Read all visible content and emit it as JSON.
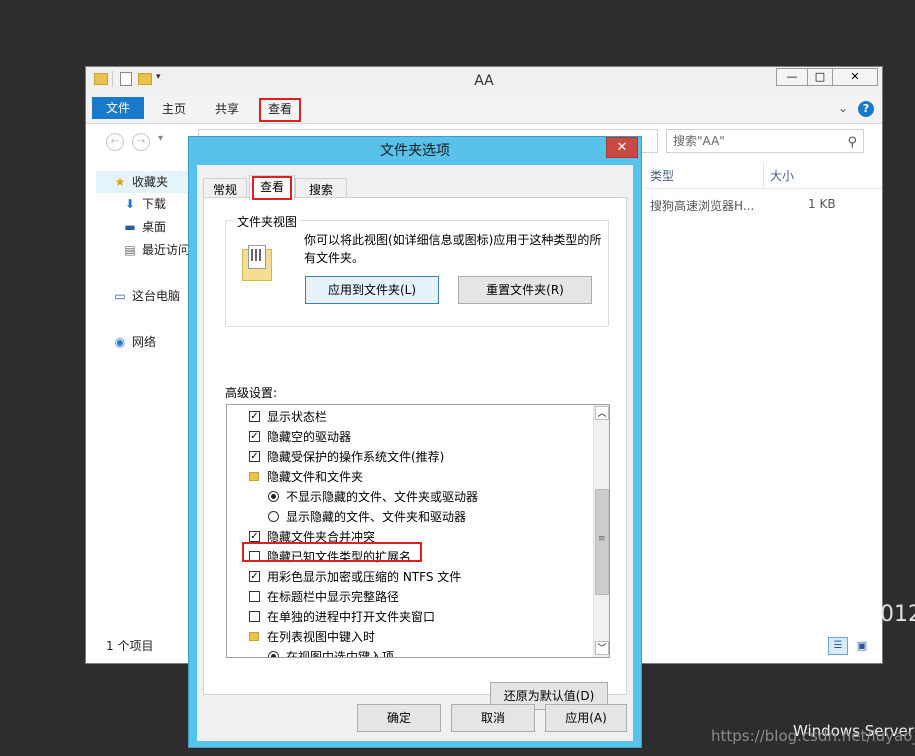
{
  "explorer": {
    "title": "AA",
    "window_buttons": {
      "minimize": "—",
      "maximize": "□",
      "close": "✕"
    },
    "ribbon_tabs": [
      "文件",
      "主页",
      "共享",
      "查看"
    ],
    "search_placeholder": "搜索\"AA\"",
    "nav_pane": {
      "favorites": "收藏夹",
      "downloads": "下载",
      "desktop": "桌面",
      "recent": "最近访问",
      "this_pc": "这台电脑",
      "network": "网络"
    },
    "columns": {
      "type": "类型",
      "size": "大小"
    },
    "file_row": {
      "type": "搜狗高速浏览器H...",
      "size": "1 KB"
    },
    "status": "1 个项目"
  },
  "dialog": {
    "title": "文件夹选项",
    "close": "✕",
    "tabs": [
      "常规",
      "查看",
      "搜索"
    ],
    "folder_view": {
      "group_title": "文件夹视图",
      "description": "你可以将此视图(如详细信息或图标)应用于这种类型的所有文件夹。",
      "apply_button": "应用到文件夹(L)",
      "reset_button": "重置文件夹(R)"
    },
    "advanced_label": "高级设置:",
    "settings": [
      {
        "kind": "check",
        "checked": true,
        "label": "显示状态栏"
      },
      {
        "kind": "check",
        "checked": true,
        "label": "隐藏空的驱动器"
      },
      {
        "kind": "check",
        "checked": true,
        "label": "隐藏受保护的操作系统文件(推荐)"
      },
      {
        "kind": "folder",
        "label": "隐藏文件和文件夹"
      },
      {
        "kind": "radio",
        "checked": true,
        "label": "不显示隐藏的文件、文件夹或驱动器"
      },
      {
        "kind": "radio",
        "checked": false,
        "label": "显示隐藏的文件、文件夹和驱动器"
      },
      {
        "kind": "check",
        "checked": true,
        "label": "隐藏文件夹合并冲突"
      },
      {
        "kind": "check",
        "checked": false,
        "label": "隐藏已知文件类型的扩展名"
      },
      {
        "kind": "check",
        "checked": true,
        "label": "用彩色显示加密或压缩的 NTFS 文件"
      },
      {
        "kind": "check",
        "checked": false,
        "label": "在标题栏中显示完整路径"
      },
      {
        "kind": "check",
        "checked": false,
        "label": "在单独的进程中打开文件夹窗口"
      },
      {
        "kind": "folder",
        "label": "在列表视图中键入时"
      },
      {
        "kind": "radio",
        "checked": true,
        "label": "在视图中选中键入项"
      }
    ],
    "restore_defaults": "还原为默认值(D)",
    "ok": "确定",
    "cancel": "取消",
    "apply": "应用(A)"
  },
  "background": {
    "side_text": "012",
    "windows_server": "Windows Server",
    "watermark": "https://blog.csdn.net/luyao_"
  }
}
